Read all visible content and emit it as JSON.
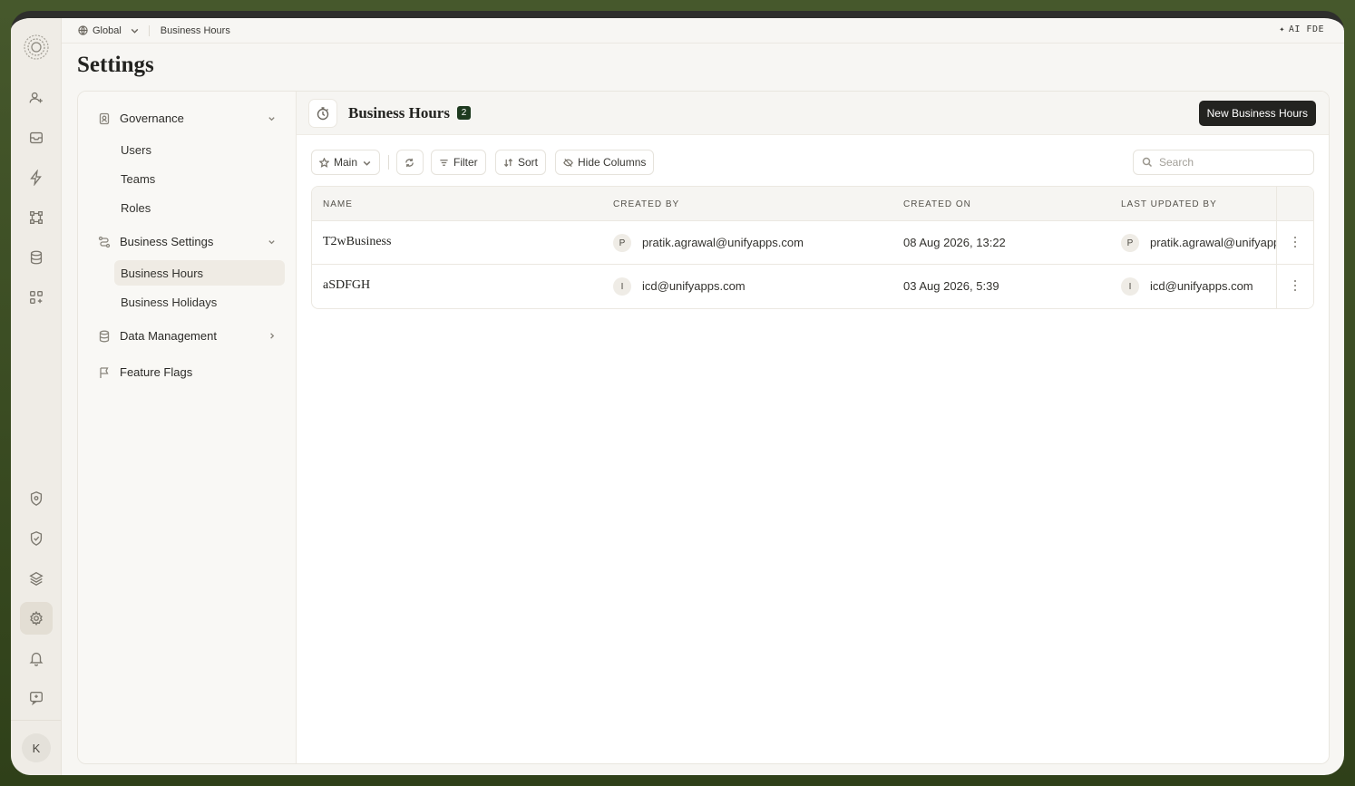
{
  "topbar": {
    "scope": "Global",
    "breadcrumb": "Business Hours",
    "ai_label": "AI FDE"
  },
  "page": {
    "title": "Settings"
  },
  "rail": {
    "icons": [
      "user-plus-icon",
      "inbox-icon",
      "bolt-icon",
      "workflow-icon",
      "database-icon",
      "apps-icon",
      "shield-icon",
      "shield-check-icon",
      "layers-icon",
      "gear-icon",
      "bell-icon",
      "feedback-icon"
    ],
    "active": "gear-icon",
    "avatar": "K"
  },
  "subnav": {
    "governance": {
      "label": "Governance",
      "items": [
        "Users",
        "Teams",
        "Roles"
      ]
    },
    "business_settings": {
      "label": "Business Settings",
      "items": [
        "Business Hours",
        "Business Holidays"
      ],
      "active": "Business Hours"
    },
    "data_management": {
      "label": "Data Management"
    },
    "feature_flags": {
      "label": "Feature Flags"
    }
  },
  "content": {
    "title": "Business Hours",
    "count": "2",
    "new_button": "New Business Hours",
    "toolbar": {
      "view": "Main",
      "filter": "Filter",
      "sort": "Sort",
      "hide_columns": "Hide Columns",
      "search_placeholder": "Search"
    },
    "table": {
      "columns": [
        "NAME",
        "CREATED BY",
        "CREATED ON",
        "LAST UPDATED BY"
      ],
      "rows": [
        {
          "name": "T2wBusiness",
          "created_by_initial": "P",
          "created_by": "pratik.agrawal@unifyapps.com",
          "created_on": "08 Aug 2026, 13:22",
          "updated_by_initial": "P",
          "updated_by": "pratik.agrawal@unifyapps.com"
        },
        {
          "name": "aSDFGH",
          "created_by_initial": "I",
          "created_by": "icd@unifyapps.com",
          "created_on": "03 Aug 2026, 5:39",
          "updated_by_initial": "I",
          "updated_by": "icd@unifyapps.com"
        }
      ]
    }
  }
}
